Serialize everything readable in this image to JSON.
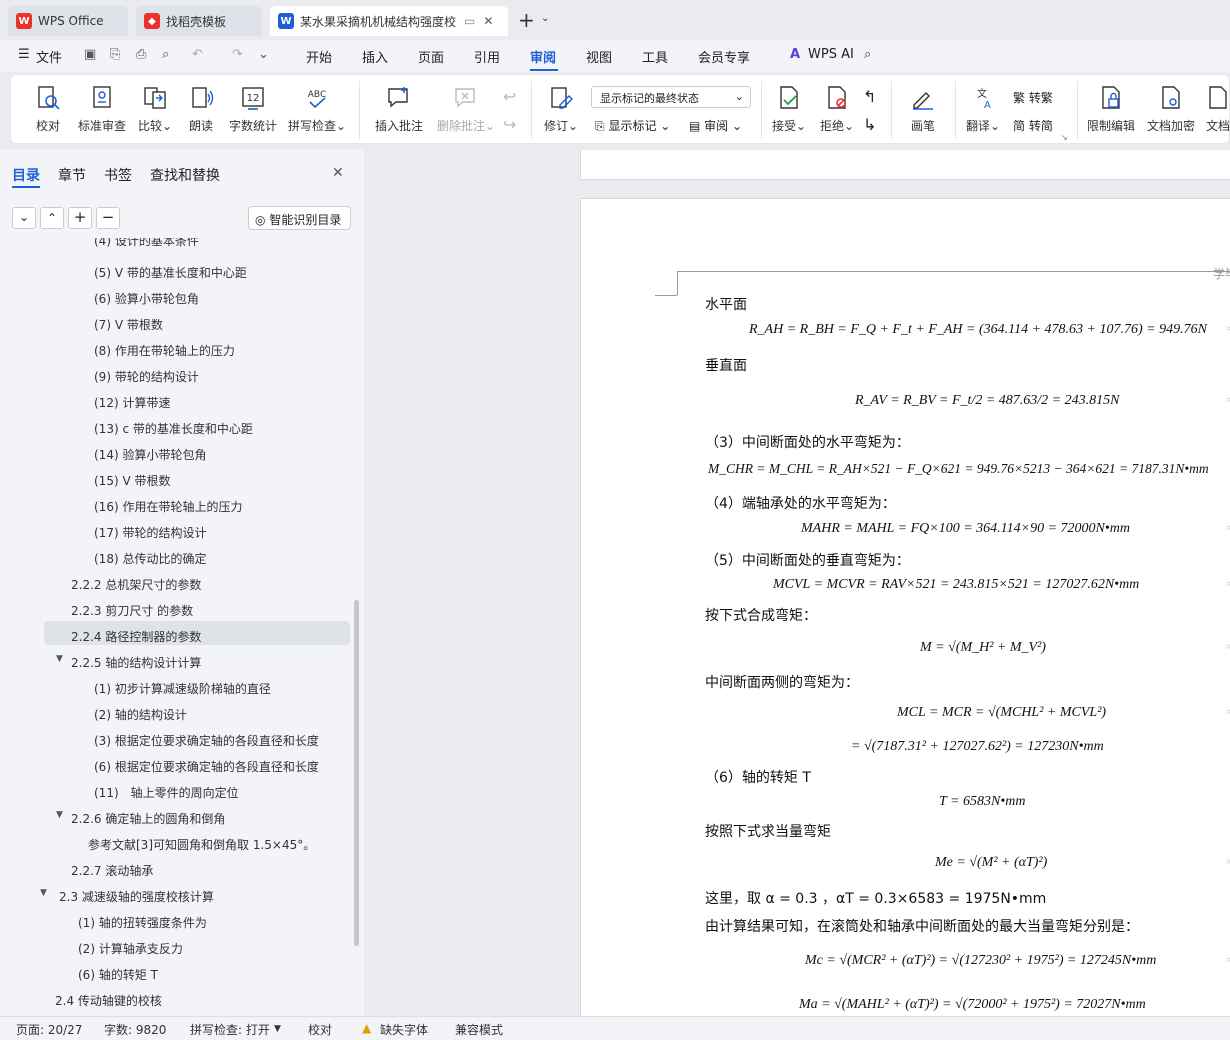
{
  "tabs": [
    {
      "label": "WPS Office"
    },
    {
      "label": "找稻壳模板"
    },
    {
      "label": "某水果采摘机机械结构强度校"
    }
  ],
  "menu": {
    "file": "文件",
    "items": [
      "开始",
      "插入",
      "页面",
      "引用",
      "审阅",
      "视图",
      "工具",
      "会员专享"
    ],
    "ai": "WPS AI",
    "active": "审阅"
  },
  "ribbon": {
    "proof": "校对",
    "std": "标准审查",
    "compare": "比较",
    "read": "朗读",
    "wordcount": "字数统计",
    "spell": "拼写检查",
    "insert_comment": "插入批注",
    "delete_comment": "删除批注",
    "revise": "修订",
    "show_state": "显示标记的最终状态",
    "show_marks": "显示标记",
    "review": "审阅",
    "accept": "接受",
    "reject": "拒绝",
    "pen": "画笔",
    "translate": "翻译",
    "to_trad": "转繁",
    "to_simp": "转简",
    "restrict": "限制编辑",
    "encrypt": "文档加密",
    "doc_more": "文档"
  },
  "sidebar": {
    "tabs": [
      "目录",
      "章节",
      "书签",
      "查找和替换"
    ],
    "smart": "智能识别目录",
    "items": [
      {
        "label": "(4) 设计的基本条件"
      },
      {
        "label": "(5) V 带的基准长度和中心距"
      },
      {
        "label": "(6) 验算小带轮包角"
      },
      {
        "label": "(7) V 带根数"
      },
      {
        "label": "(8) 作用在带轮轴上的压力"
      },
      {
        "label": "(9) 带轮的结构设计"
      },
      {
        "label": "(12) 计算带速"
      },
      {
        "label": "(13) c 带的基准长度和中心距"
      },
      {
        "label": "(14) 验算小带轮包角"
      },
      {
        "label": "(15) V 带根数"
      },
      {
        "label": "(16) 作用在带轮轴上的压力"
      },
      {
        "label": "(17) 带轮的结构设计"
      },
      {
        "label": "(18) 总传动比的确定"
      },
      {
        "label": "2.2.2 总机架尺寸的参数"
      },
      {
        "label": "2.2.3 剪刀尺寸 的参数"
      },
      {
        "label": "2.2.4 路径控制器的参数"
      },
      {
        "label": "2.2.5 轴的结构设计计算"
      },
      {
        "label": "(1) 初步计算减速级阶梯轴的直径"
      },
      {
        "label": "(2) 轴的结构设计"
      },
      {
        "label": "(3) 根据定位要求确定轴的各段直径和长度"
      },
      {
        "label": "(6) 根据定位要求确定轴的各段直径和长度"
      },
      {
        "label": "(11)　轴上零件的周向定位"
      },
      {
        "label": "2.2.6  确定轴上的圆角和倒角"
      },
      {
        "label": "参考文献[3]可知圆角和倒角取 1.5×45°。"
      },
      {
        "label": "2.2.7 滚动轴承"
      },
      {
        "label": "2.3 减速级轴的强度校核计算"
      },
      {
        "label": "(1) 轴的扭转强度条件为"
      },
      {
        "label": "(2) 计算轴承支反力"
      },
      {
        "label": "(6) 轴的转矩 T"
      },
      {
        "label": "2.4 传动轴键的校核"
      }
    ]
  },
  "doc": {
    "header_right": "学毕",
    "lines": [
      "水平面",
      "R_AH = R_BH = F_Q + F_t + F_AH = (364.114 + 478.63 + 107.76) = 949.76N",
      "垂直面",
      "R_AV = R_BV = F_t/2 = 487.63/2 = 243.815N",
      "（3）中间断面处的水平弯矩为：",
      "M_CHR = M_CHL = R_AH×521 − F_Q×621 = 949.76×5213 − 364×621 = 7187.31N•mm",
      "（4）端轴承处的水平弯矩为：",
      "MAHR = MAHL = FQ×100 = 364.114×90 = 72000N•mm",
      "（5）中间断面处的垂直弯矩为：",
      "MCVL = MCVR = RAV×521 = 243.815×521 = 127027.62N•mm",
      "按下式合成弯矩：",
      "M = √(M_H² + M_V²)",
      "中间断面两侧的弯矩为：",
      "MCL = MCR = √(MCHL² + MCVL²)",
      "= √(7187.31² + 127027.62²) = 127230N•mm",
      "（6）轴的转矩 T",
      "T = 6583N•mm",
      "按照下式求当量弯矩",
      "Me = √(M² + (αT)²)",
      "这里，取 α = 0.3 ，αT = 0.3×6583 = 1975N•mm",
      "由计算结果可知，在滚筒处和轴承中间断面处的最大当量弯矩分别是：",
      "Mc = √(MCR² + (αT)²) = √(127230² + 1975²) = 127245N•mm",
      "Ma = √(MAHL² + (αT)²) = √(72000² + 1975²) = 72027N•mm"
    ]
  },
  "status": {
    "page": "页面: 20/27",
    "words": "字数: 9820",
    "spell": "拼写检查: 打开",
    "proof": "校对",
    "missing_font": "缺失字体",
    "compat": "兼容模式"
  },
  "colors": {
    "accent": "#1f5fd6",
    "wps_red": "#e8322e"
  }
}
